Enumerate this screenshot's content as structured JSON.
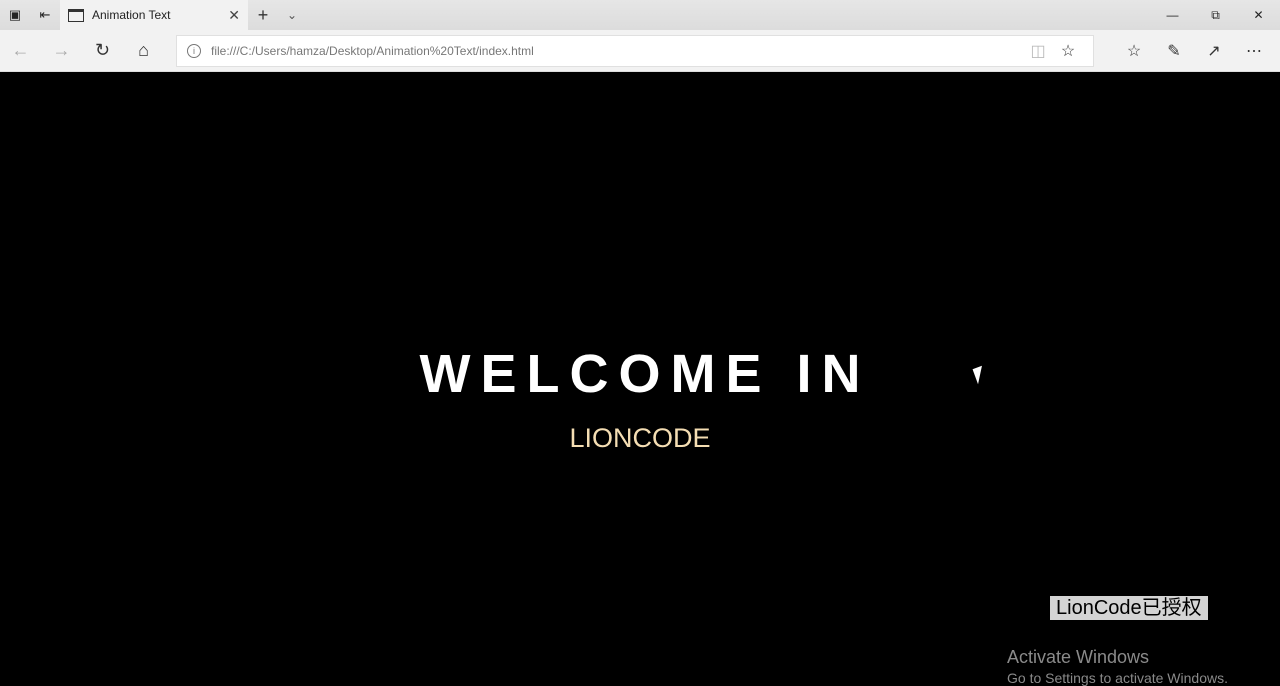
{
  "browser": {
    "tab_title": "Animation Text",
    "url": "file:///C:/Users/hamza/Desktop/Animation%20Text/index.html",
    "icons": [
      "tab-set-aside-icon",
      "tabs-preview-icon",
      "page-icon",
      "close-icon",
      "plus-icon",
      "chevron-down-icon",
      "back-icon",
      "forward-icon",
      "refresh-icon",
      "home-icon",
      "info-icon",
      "reading-view-icon",
      "star-icon",
      "favorites-icon",
      "pen-icon",
      "share-icon",
      "more-icon",
      "minimize-icon",
      "restore-icon",
      "close-window-icon"
    ]
  },
  "page": {
    "heading": "WELCOME IN",
    "subheading": "LIONCODE",
    "subheading_color": "#f5deb3"
  },
  "watermark": "LionCode已授权",
  "activation": {
    "title": "Activate Windows",
    "message": "Go to Settings to activate Windows."
  }
}
